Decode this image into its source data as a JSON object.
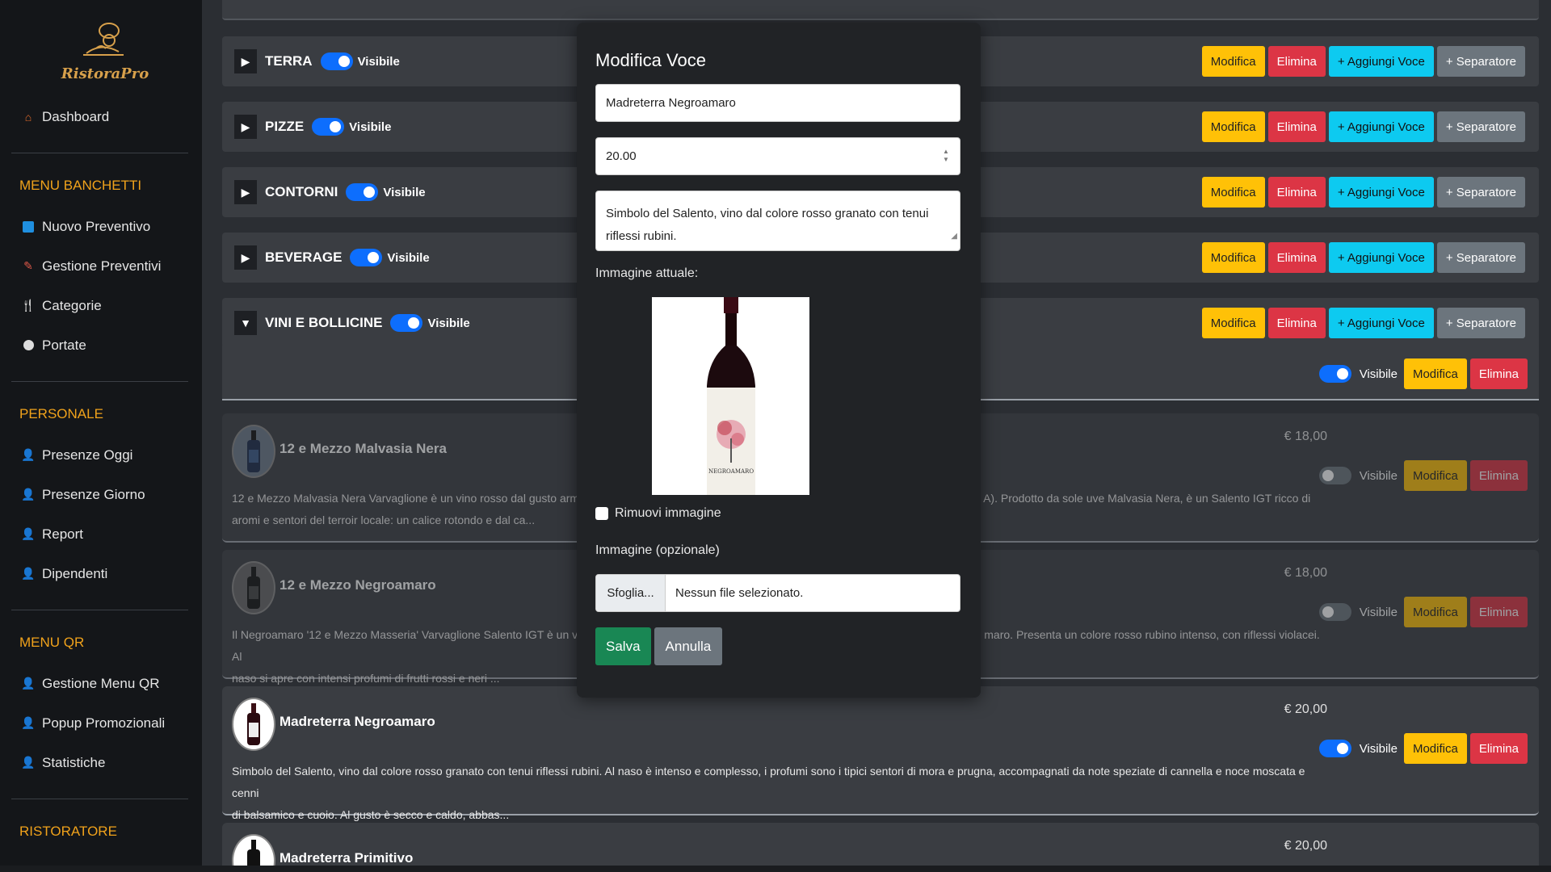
{
  "brand": {
    "logo_text": "RistoraPro"
  },
  "sidebar": {
    "dashboard": "Dashboard",
    "sections": [
      {
        "title": "MENU BANCHETTI",
        "items": [
          "Nuovo Preventivo",
          "Gestione Preventivi",
          "Categorie",
          "Portate"
        ]
      },
      {
        "title": "PERSONALE",
        "items": [
          "Presenze Oggi",
          "Presenze Giorno",
          "Report",
          "Dipendenti"
        ]
      },
      {
        "title": "MENU QR",
        "items": [
          "Gestione Menu QR",
          "Popup Promozionali",
          "Statistiche"
        ]
      },
      {
        "title": "RISTORATORE",
        "items": []
      }
    ]
  },
  "categories": [
    {
      "name": "TERRA",
      "visible_label": "Visibile",
      "expanded": false
    },
    {
      "name": "PIZZE",
      "visible_label": "Visibile",
      "expanded": false
    },
    {
      "name": "CONTORNI",
      "visible_label": "Visibile",
      "expanded": false
    },
    {
      "name": "BEVERAGE",
      "visible_label": "Visibile",
      "expanded": false
    },
    {
      "name": "VINI E BOLLICINE",
      "visible_label": "Visibile",
      "expanded": true
    }
  ],
  "buttons": {
    "edit": "Modifica",
    "delete": "Elimina",
    "add_item": "+ Aggiungi Voce",
    "separator": "+ Separatore",
    "visible": "Visibile"
  },
  "items": [
    {
      "name": "12 e Mezzo Malvasia Nera",
      "price": "€ 18,00",
      "visible": false,
      "desc": "12 e Mezzo Malvasia Nera Varvaglione è un vino rosso dal gusto arm",
      "desc_tail": "A). Prodotto da sole uve Malvasia Nera, è un Salento IGT ricco di",
      "desc2": "aromi e sentori del terroir locale: un calice rotondo e dal ca..."
    },
    {
      "name": "12 e Mezzo Negroamaro",
      "price": "€ 18,00",
      "visible": false,
      "desc": "Il Negroamaro '12 e Mezzo Masseria' Varvaglione Salento IGT è un vi",
      "desc_tail": "maro. Presenta un colore rosso rubino intenso, con riflessi violacei. Al",
      "desc2": "naso si apre con intensi profumi di frutti rossi e neri ..."
    },
    {
      "name": "Madreterra Negroamaro",
      "price": "€ 20,00",
      "visible": true,
      "desc": "Simbolo del Salento, vino dal colore rosso granato con tenui riflessi rubini. Al naso è intenso e complesso, i profumi sono i tipici sentori di mora e prugna, accompagnati da note speziate di cannella e noce moscata e cenni",
      "desc_tail": "",
      "desc2": "di balsamico e cuoio. Al gusto è secco e caldo, abbas..."
    },
    {
      "name": "Madreterra Primitivo",
      "price": "€ 20,00",
      "visible": true,
      "desc": "",
      "desc_tail": "",
      "desc2": ""
    }
  ],
  "modal": {
    "title": "Modifica Voce",
    "name_value": "Madreterra Negroamaro",
    "price_value": "20.00",
    "description_value": "Simbolo del Salento, vino dal colore rosso granato con tenui riflessi rubini.",
    "current_image_label": "Immagine attuale:",
    "bottle_label": "NEGROAMARO",
    "remove_image_label": "Rimuovi immagine",
    "optional_image_label": "Immagine (opzionale)",
    "browse_label": "Sfoglia...",
    "no_file_label": "Nessun file selezionato.",
    "save_label": "Salva",
    "cancel_label": "Annulla"
  },
  "colors": {
    "accent": "#f0a21b",
    "primary": "#0d6efd",
    "warning": "#ffc107",
    "danger": "#dc3545",
    "info": "#0dcaf0",
    "secondary": "#6c757d",
    "success": "#198754"
  }
}
